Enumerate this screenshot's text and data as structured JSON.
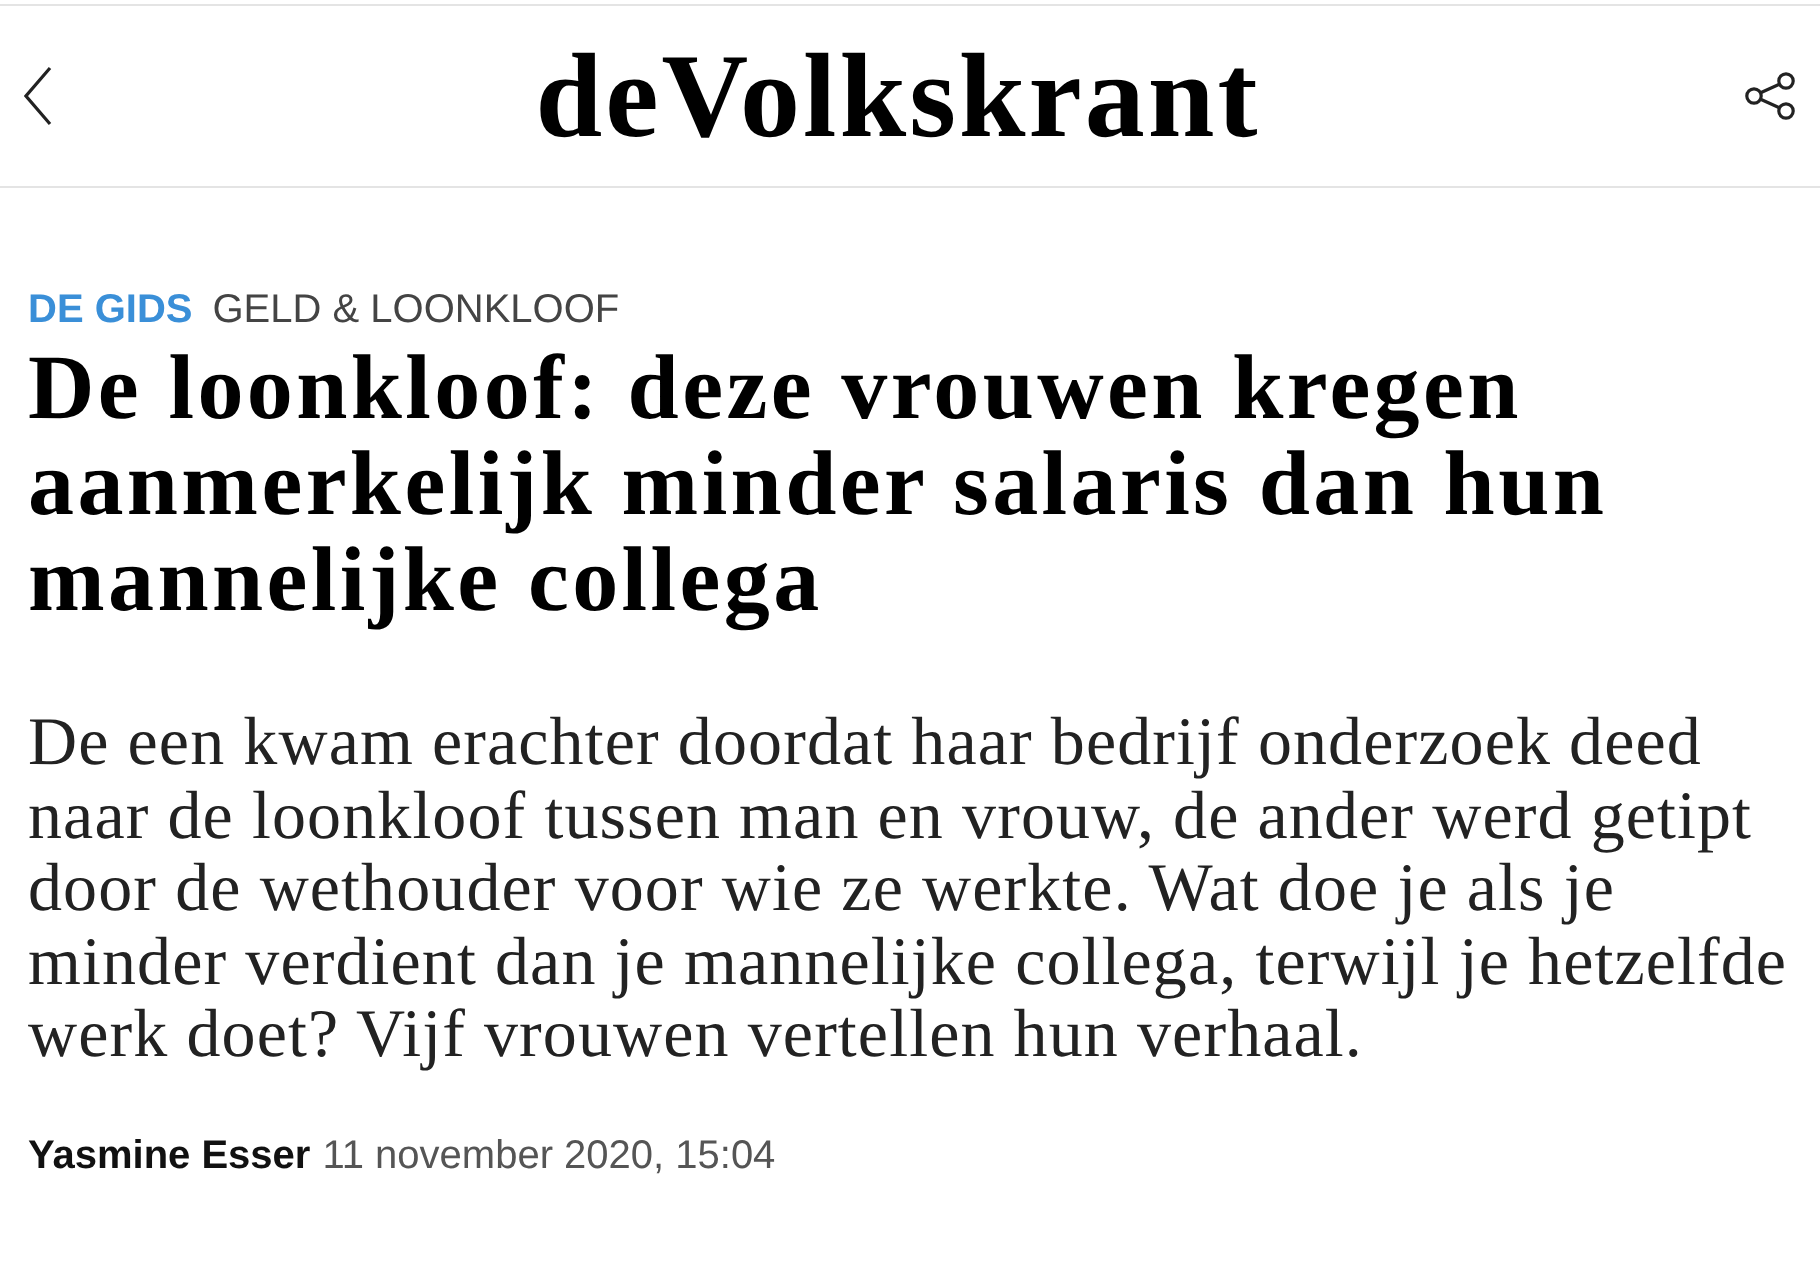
{
  "header": {
    "logo": "deVolkskrant"
  },
  "article": {
    "section": "DE GIDS",
    "topic": "GELD & LOONKLOOF",
    "headline": "De loonkloof: deze vrouwen kregen aanmerkelijk minder salaris dan hun mannelijke collega",
    "lede": "De een kwam erachter doordat haar bedrijf onderzoek deed naar de loonkloof tussen man en vrouw, de ander werd getipt door de wethouder voor wie ze werkte. Wat doe je als je minder verdient dan je mannelijke collega, terwijl je hetzelfde werk doet? Vijf vrouwen vertellen hun verhaal.",
    "author": "Yasmine Esser",
    "date": "11 november 2020, 15:04"
  }
}
